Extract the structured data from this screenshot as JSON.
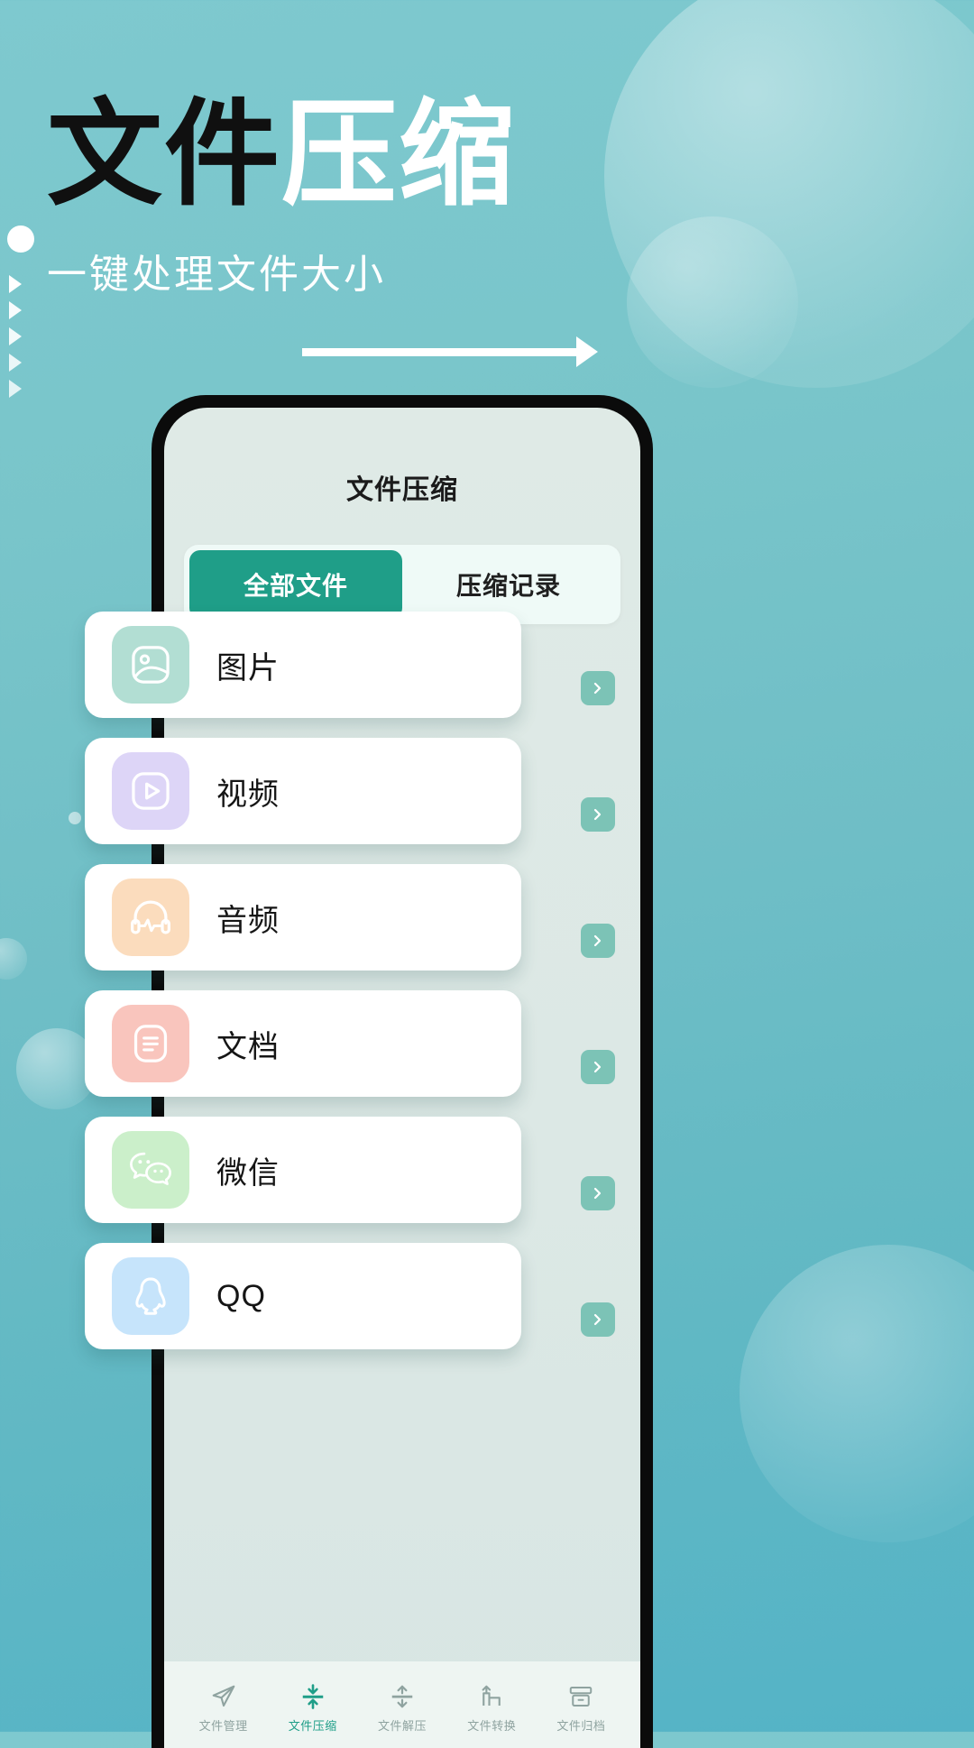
{
  "poster": {
    "headline_dark": "文件",
    "headline_light": "压缩",
    "subtitle": "一键处理文件大小"
  },
  "colors": {
    "background_top": "#7ec9cf",
    "background_bottom": "#54b3c6",
    "accent_teal": "#1f9e88",
    "chevron_bg": "#7cc3b6",
    "screen_bg": "#dce8e5"
  },
  "phone": {
    "app_title": "文件压缩",
    "tabs": [
      {
        "label": "全部文件",
        "active": true
      },
      {
        "label": "压缩记录",
        "active": false
      }
    ],
    "list": [
      {
        "label": "图片",
        "icon": "image-icon",
        "tile_color": "#b2ded3"
      },
      {
        "label": "视频",
        "icon": "video-icon",
        "tile_color": "#ddd5f7"
      },
      {
        "label": "音频",
        "icon": "audio-icon",
        "tile_color": "#fbdcbd"
      },
      {
        "label": "文档",
        "icon": "document-icon",
        "tile_color": "#f9c5bd"
      },
      {
        "label": "微信",
        "icon": "wechat-icon",
        "tile_color": "#cbefca"
      },
      {
        "label": "QQ",
        "icon": "qq-icon",
        "tile_color": "#c6e4fb"
      }
    ],
    "bottom_nav": [
      {
        "label": "文件管理",
        "icon": "send-icon",
        "active": false
      },
      {
        "label": "文件压缩",
        "icon": "compress-icon",
        "active": true
      },
      {
        "label": "文件解压",
        "icon": "extract-icon",
        "active": false
      },
      {
        "label": "文件转换",
        "icon": "convert-icon",
        "active": false
      },
      {
        "label": "文件归档",
        "icon": "archive-icon",
        "active": false
      }
    ]
  }
}
